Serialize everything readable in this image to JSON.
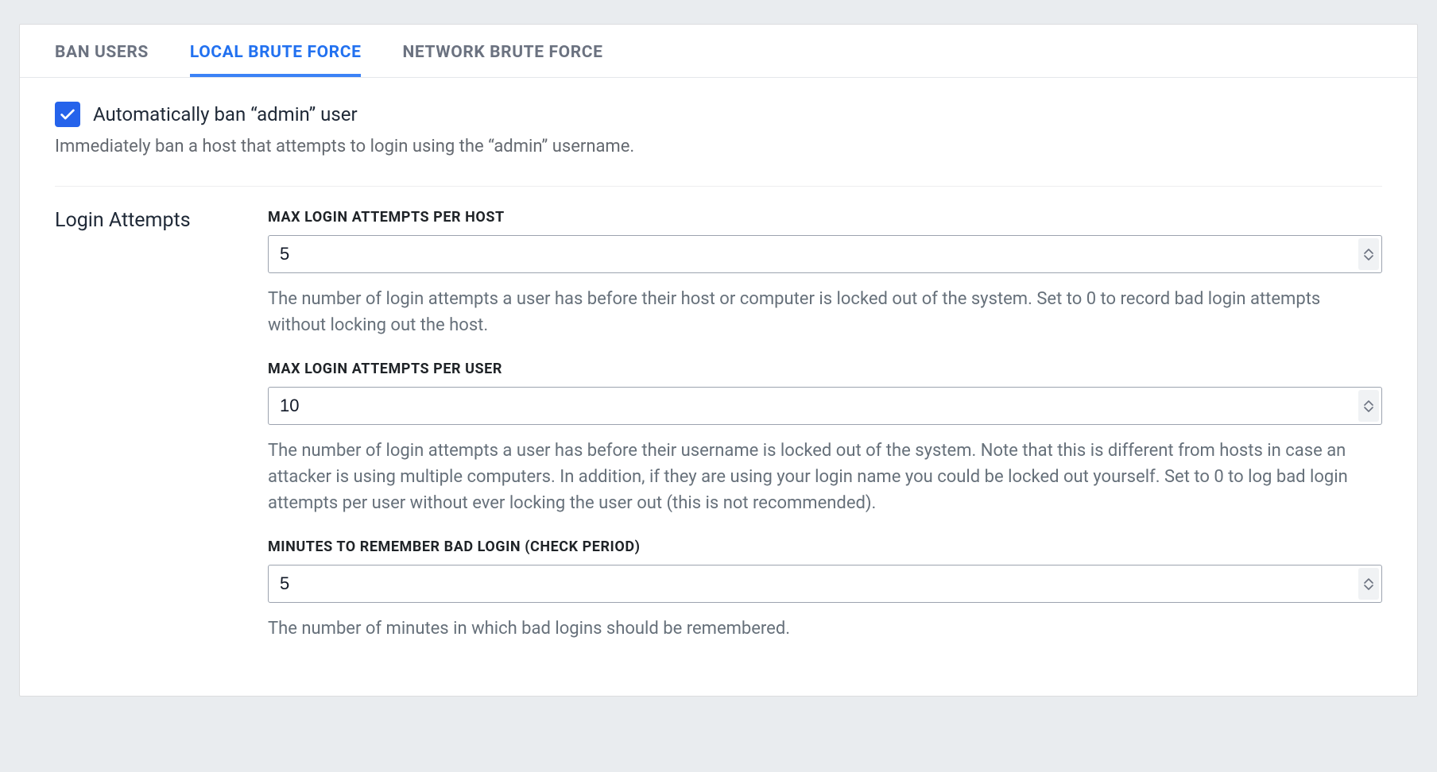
{
  "tabs": {
    "ban_users": "BAN USERS",
    "local_brute_force": "LOCAL BRUTE FORCE",
    "network_brute_force": "NETWORK BRUTE FORCE"
  },
  "auto_ban": {
    "label": "Automatically ban “admin” user",
    "help": "Immediately ban a host that attempts to login using the “admin” username."
  },
  "login_attempts": {
    "section_title": "Login Attempts",
    "fields": {
      "max_per_host": {
        "label": "MAX LOGIN ATTEMPTS PER HOST",
        "value": "5",
        "help": "The number of login attempts a user has before their host or computer is locked out of the system. Set to 0 to record bad login attempts without locking out the host."
      },
      "max_per_user": {
        "label": "MAX LOGIN ATTEMPTS PER USER",
        "value": "10",
        "help": "The number of login attempts a user has before their username is locked out of the system. Note that this is different from hosts in case an attacker is using multiple computers. In addition, if they are using your login name you could be locked out yourself. Set to 0 to log bad login attempts per user without ever locking the user out (this is not recommended)."
      },
      "minutes_remember": {
        "label": "MINUTES TO REMEMBER BAD LOGIN (CHECK PERIOD)",
        "value": "5",
        "help": "The number of minutes in which bad logins should be remembered."
      }
    }
  }
}
